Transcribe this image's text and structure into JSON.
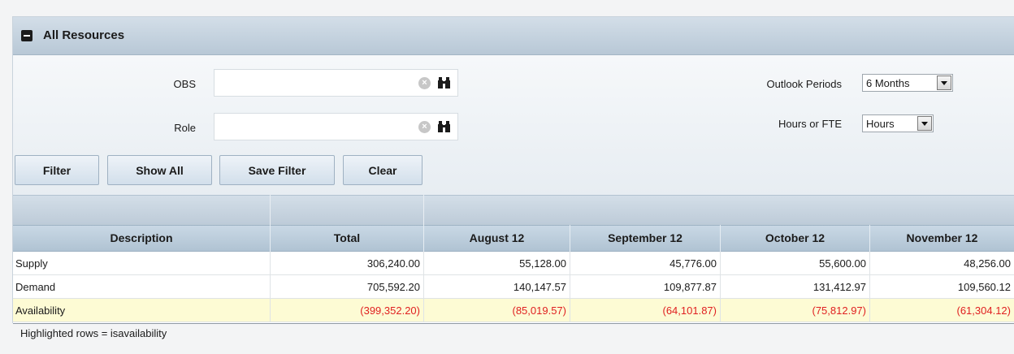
{
  "portlet": {
    "title": "All Resources"
  },
  "filters": {
    "obs_label": "OBS",
    "obs_value": "",
    "role_label": "Role",
    "role_value": "",
    "outlook_label": "Outlook Periods",
    "outlook_value": "6 Months",
    "hours_label": "Hours or FTE",
    "hours_value": "Hours"
  },
  "buttons": {
    "filter": "Filter",
    "show_all": "Show All",
    "save_filter": "Save Filter",
    "clear": "Clear"
  },
  "grid": {
    "columns": [
      "Description",
      "Total",
      "August 12",
      "September 12",
      "October 12",
      "November 12"
    ],
    "rows": [
      {
        "description": "Supply",
        "values": [
          "306,240.00",
          "55,128.00",
          "45,776.00",
          "55,600.00",
          "48,256.00"
        ],
        "highlighted": false
      },
      {
        "description": "Demand",
        "values": [
          "705,592.20",
          "140,147.57",
          "109,877.87",
          "131,412.97",
          "109,560.12"
        ],
        "highlighted": false
      },
      {
        "description": "Availability",
        "values": [
          "(399,352.20)",
          "(85,019.57)",
          "(64,101.87)",
          "(75,812.97)",
          "(61,304.12)"
        ],
        "highlighted": true
      }
    ]
  },
  "footnote": "Highlighted rows = isavailability",
  "colors": {
    "header_blue": "#b8c8d6",
    "highlight_row": "#fdfbd4",
    "negative_value": "#e02020"
  }
}
